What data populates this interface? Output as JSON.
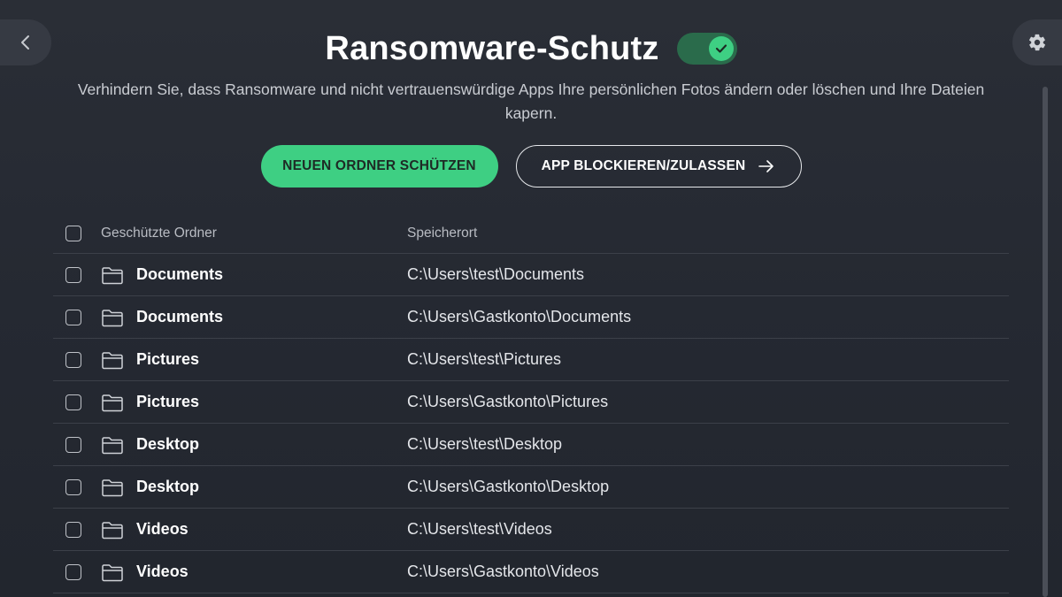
{
  "header": {
    "title": "Ransomware-Schutz",
    "toggle_on": true
  },
  "description": "Verhindern Sie, dass Ransomware und nicht vertrauenswürdige Apps Ihre persönlichen Fotos ändern oder löschen und Ihre Dateien kapern.",
  "actions": {
    "primary_label": "NEUEN ORDNER SCHÜTZEN",
    "secondary_label": "APP BLOCKIEREN/ZULASSEN"
  },
  "table": {
    "col_name": "Geschützte Ordner",
    "col_path": "Speicherort",
    "rows": [
      {
        "name": "Documents",
        "path": "C:\\Users\\test\\Documents"
      },
      {
        "name": "Documents",
        "path": "C:\\Users\\Gastkonto\\Documents"
      },
      {
        "name": "Pictures",
        "path": "C:\\Users\\test\\Pictures"
      },
      {
        "name": "Pictures",
        "path": "C:\\Users\\Gastkonto\\Pictures"
      },
      {
        "name": "Desktop",
        "path": "C:\\Users\\test\\Desktop"
      },
      {
        "name": "Desktop",
        "path": "C:\\Users\\Gastkonto\\Desktop"
      },
      {
        "name": "Videos",
        "path": "C:\\Users\\test\\Videos"
      },
      {
        "name": "Videos",
        "path": "C:\\Users\\Gastkonto\\Videos"
      }
    ]
  },
  "icons": {
    "back": "chevron-left-icon",
    "settings": "gear-icon",
    "toggle_check": "check-icon",
    "folder": "folder-icon",
    "arrow": "arrow-right-icon"
  },
  "colors": {
    "accent": "#3ecf83",
    "toggle_track": "#2a6b4b",
    "background": "#262a32"
  }
}
